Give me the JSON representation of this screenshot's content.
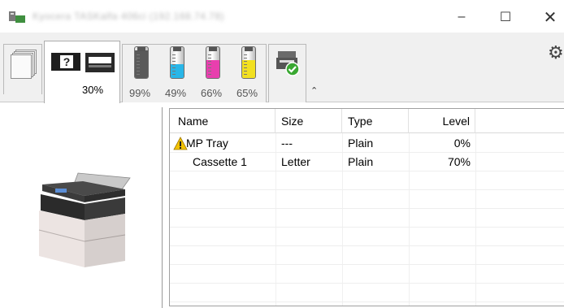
{
  "window": {
    "title": "Kyocera TASKalfa 406ci (192.168.74.78)",
    "min_glyph": "–",
    "max_glyph": "☐",
    "close_glyph": "✕"
  },
  "toolbar": {
    "tray_percent": "30%",
    "toner": [
      {
        "label": "99%",
        "color": "#5a5a5a",
        "level": 0.99
      },
      {
        "label": "49%",
        "color": "#29b6e8",
        "level": 0.49
      },
      {
        "label": "66%",
        "color": "#e83fae",
        "level": 0.66
      },
      {
        "label": "65%",
        "color": "#f2e020",
        "level": 0.65
      }
    ],
    "help_glyph": "?",
    "caret_glyph": "⌃",
    "gear_glyph": "⚙"
  },
  "table": {
    "headers": [
      "Name",
      "Size",
      "Type",
      "Level"
    ],
    "rows": [
      {
        "name": "MP Tray",
        "size": "---",
        "type": "Plain",
        "level": "0%",
        "warning": true
      },
      {
        "name": "Cassette 1",
        "size": "Letter",
        "type": "Plain",
        "level": "70%",
        "warning": false
      }
    ]
  },
  "colors": {
    "warning": "#f2c200",
    "status_check": "#3aa832"
  }
}
